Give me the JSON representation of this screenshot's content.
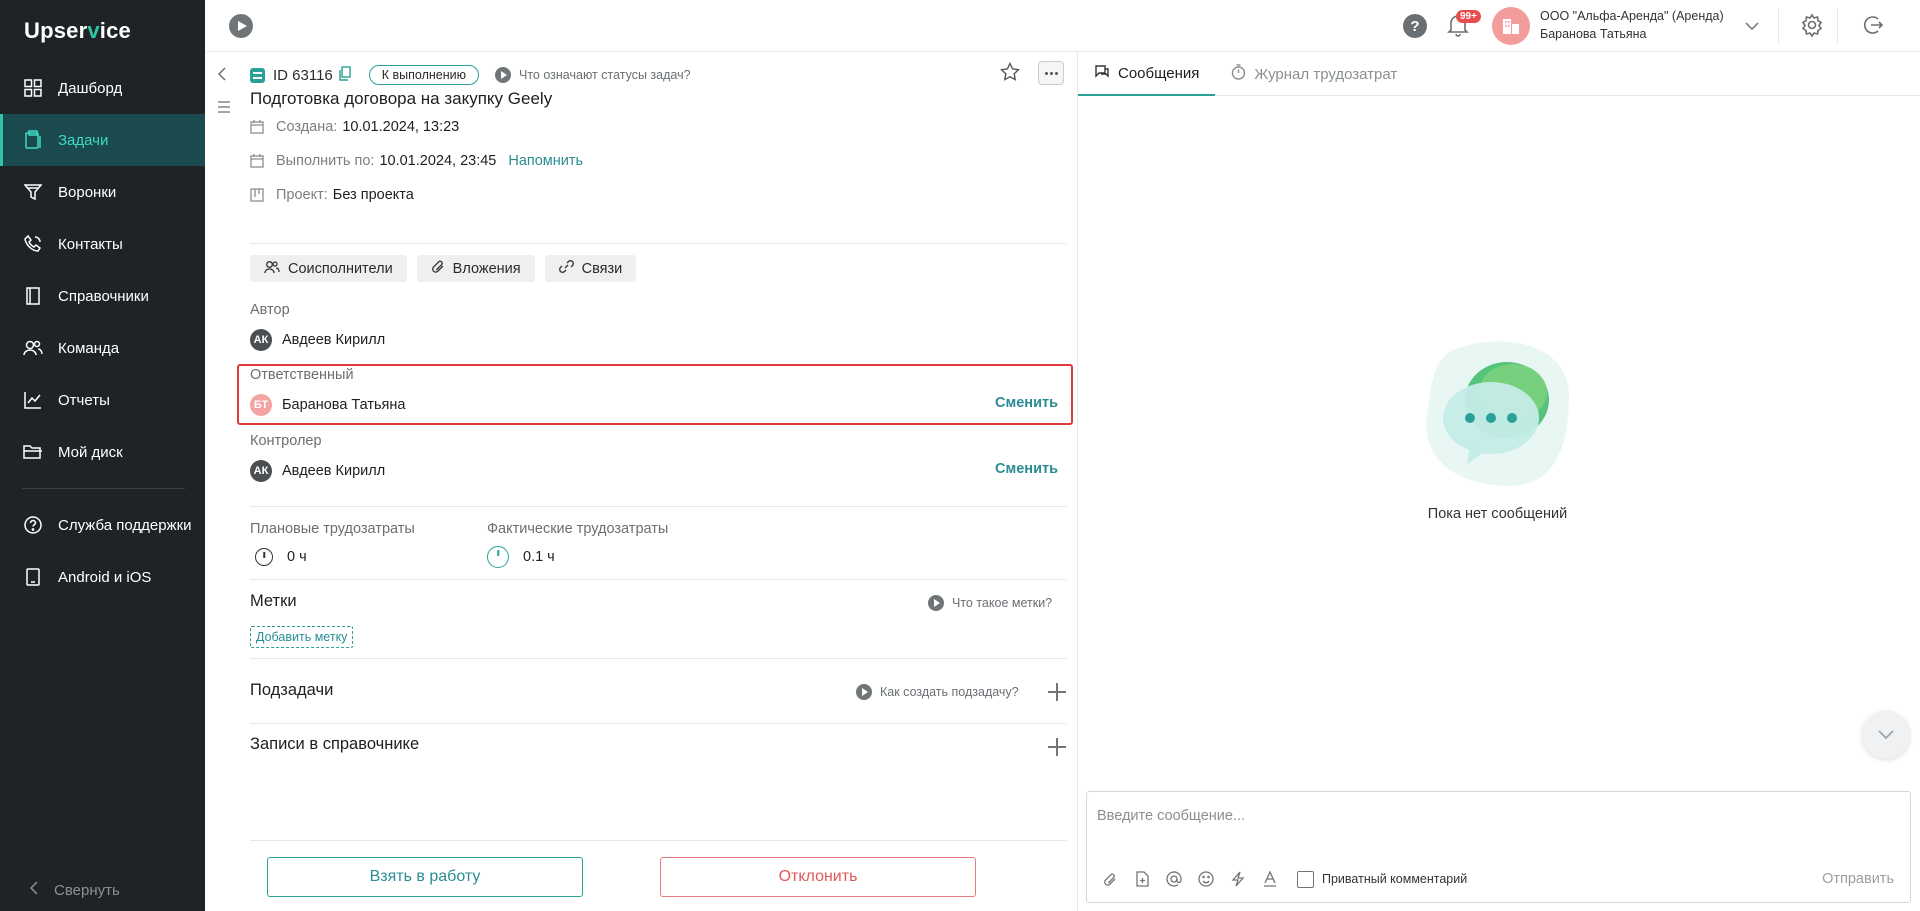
{
  "app": {
    "logo_prefix": "Upser",
    "logo_check": "v",
    "logo_suffix": "ice"
  },
  "sidebar": {
    "items": [
      {
        "label": "Дашборд",
        "icon": "grid-icon"
      },
      {
        "label": "Задачи",
        "icon": "clipboard-icon",
        "active": true
      },
      {
        "label": "Воронки",
        "icon": "funnel-icon"
      },
      {
        "label": "Контакты",
        "icon": "phone-icon"
      },
      {
        "label": "Справочники",
        "icon": "book-icon"
      },
      {
        "label": "Команда",
        "icon": "team-icon"
      },
      {
        "label": "Отчеты",
        "icon": "chart-icon"
      },
      {
        "label": "Мой диск",
        "icon": "folder-icon"
      }
    ],
    "bottom_items": [
      {
        "label": "Служба поддержки",
        "icon": "help-circle-icon"
      },
      {
        "label": "Android и iOS",
        "icon": "mobile-icon"
      }
    ],
    "collapse_label": "Свернуть"
  },
  "topbar": {
    "notifications_badge": "99+",
    "org_line1": "ООО \"Альфа-Аренда\" (Аренда)",
    "org_line2": "Баранова Татьяна",
    "help_glyph": "?"
  },
  "task": {
    "id": "ID 63116",
    "status": "К выполнению",
    "status_hint": "Что означают статусы задач?",
    "title": "Подготовка договора на закупку Geely",
    "created_label": "Создана:",
    "created_value": "10.01.2024, 13:23",
    "due_label": "Выполнить по:",
    "due_value": "10.01.2024, 23:45",
    "remind_label": "Напомнить",
    "project_label": "Проект:",
    "project_value": "Без проекта",
    "chips": {
      "coexecutors": "Соисполнители",
      "attachments": "Вложения",
      "links": "Связи"
    },
    "author_label": "Автор",
    "author": {
      "initials": "АК",
      "name": "Авдеев Кирилл"
    },
    "responsible_label": "Ответственный",
    "responsible": {
      "initials": "БТ",
      "name": "Баранова Татьяна"
    },
    "controller_label": "Контролер",
    "controller": {
      "initials": "АК",
      "name": "Авдеев Кирилл"
    },
    "change_label": "Сменить",
    "planned_label": "Плановые трудозатраты",
    "planned_value": "0 ч",
    "actual_label": "Фактические трудозатраты",
    "actual_value": "0.1 ч",
    "tags_title": "Метки",
    "tags_hint": "Что такое метки?",
    "add_tag": "Добавить метку",
    "subtasks_title": "Подзадачи",
    "subtasks_hint": "Как создать подзадачу?",
    "records_title": "Записи в справочнике",
    "btn_take": "Взять в работу",
    "btn_reject": "Отклонить"
  },
  "chat": {
    "tab_messages": "Сообщения",
    "tab_journal": "Журнал трудозатрат",
    "empty_text": "Пока нет сообщений",
    "input_placeholder": "Введите сообщение...",
    "private_label": "Приватный комментарий",
    "send_label": "Отправить"
  },
  "colors": {
    "accent": "#2aa198",
    "sidebar_bg": "#1f2326",
    "highlight": "#e03a3a",
    "reject": "#e05858"
  }
}
